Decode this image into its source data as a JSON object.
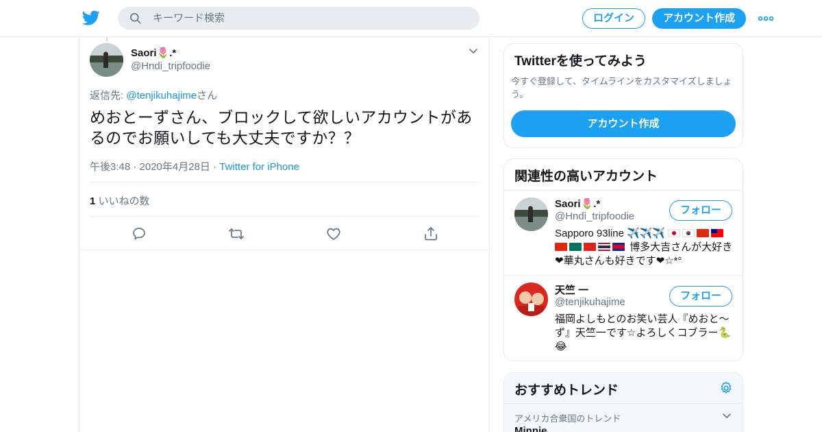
{
  "header": {
    "search_placeholder": "キーワード検索",
    "login_label": "ログイン",
    "signup_label": "アカウント作成"
  },
  "tweet": {
    "author_name": "Saori🌷.*",
    "author_handle": "@Hndi_tripfoodie",
    "reply_prefix": "返信先: ",
    "reply_to": "@tenjikuhajime",
    "reply_suffix": "さん",
    "text": "めおとーずさん、ブロックして欲しいアカウントがあるのでお願いしても大丈夫ですか？？",
    "time": "午後3:48 · 2020年4月28日 · ",
    "source": "Twitter for iPhone",
    "like_count": "1",
    "like_label": " いいねの数"
  },
  "sidebar": {
    "try_card": {
      "title": "Twitterを使ってみよう",
      "description": "今すぐ登録して、タイムラインをカスタマイズしましょう。",
      "cta": "アカウント作成"
    },
    "related": {
      "title": "関連性の高いアカウント",
      "follow_label": "フォロー",
      "accounts": [
        {
          "name": "Saori🌷.*",
          "handle": "@Hndi_tripfoodie",
          "bio_prefix": "Sapporo 93line ✈️✈️✈️",
          "bio_rest": "博多大吉さんが大好き❤︎華丸さんも好きです❤︎☆*°"
        },
        {
          "name": "天竺 一",
          "handle": "@tenjikuhajime",
          "bio": "福岡よしもとのお笑い芸人『めおと〜ず』天竺一です☆よろしくコブラー🐍😂"
        }
      ]
    },
    "trends": {
      "title": "おすすめトレンド",
      "items": [
        {
          "location": "アメリカ合衆国のトレンド",
          "name": "Minnie"
        }
      ]
    }
  },
  "colors": {
    "accent": "#1da1f2",
    "link": "#1b95e0",
    "secondary_text": "#657786",
    "border": "#e6ecf0"
  },
  "icons": [
    "twitter-logo-icon",
    "search-icon",
    "more-icon",
    "chevron-down-icon",
    "reply-icon",
    "retweet-icon",
    "like-icon",
    "share-icon",
    "gear-icon"
  ]
}
